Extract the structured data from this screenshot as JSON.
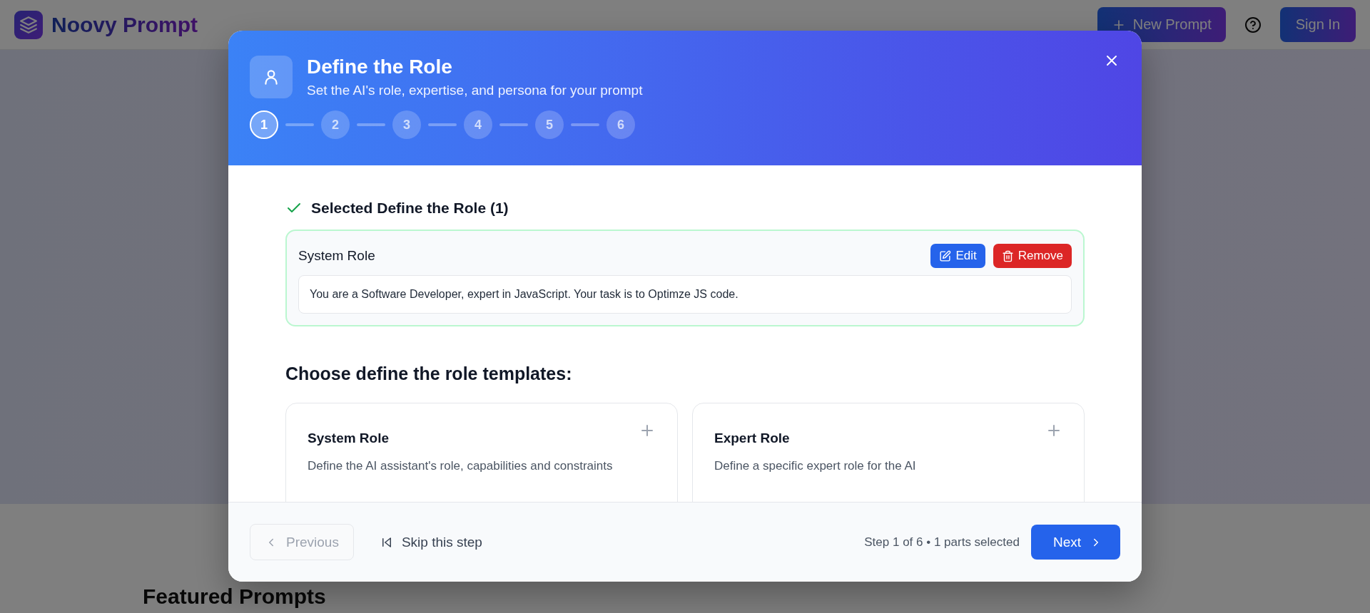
{
  "app_bar": {
    "brand": "Noovy Prompt",
    "new_prompt_button": "New Prompt",
    "sign_in_button": "Sign In"
  },
  "featured": {
    "title": "Featured Prompts"
  },
  "dialog": {
    "title": "Define the Role",
    "subtitle": "Set the AI's role, expertise, and persona for your prompt",
    "steps": [
      {
        "label": "1",
        "selected": true
      },
      {
        "label": "2",
        "selected": false
      },
      {
        "label": "3",
        "selected": false
      },
      {
        "label": "4",
        "selected": false
      },
      {
        "label": "5",
        "selected": false
      },
      {
        "label": "6",
        "selected": false
      }
    ],
    "selected_heading": "Selected Define the Role (1)",
    "selected_parts": [
      {
        "name": "System Role",
        "content": "You are a Software Developer, expert in JavaScript. Your task is to Optimze JS code.",
        "edit_button": "Edit",
        "remove_button": "Remove"
      }
    ],
    "templates_heading": "Choose define the role templates:",
    "templates": [
      {
        "title": "System Role",
        "description": "Define the AI assistant's role, capabilities and constraints"
      },
      {
        "title": "Expert Role",
        "description": "Define a specific expert role for the AI"
      }
    ],
    "previous_button": {
      "label": "Previous",
      "disabled": true
    },
    "skip_button": "Skip this step",
    "status": "Step 1 of 6 • 1 parts selected",
    "next_button": "Next"
  }
}
